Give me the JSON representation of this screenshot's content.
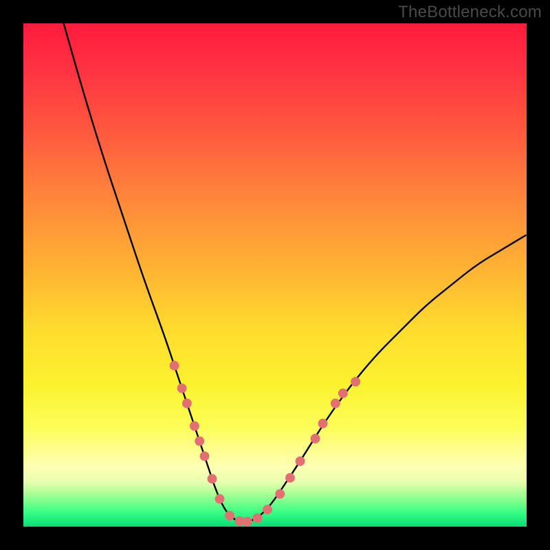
{
  "watermark": "TheBottleneck.com",
  "chart_data": {
    "type": "line",
    "title": "",
    "xlabel": "",
    "ylabel": "",
    "xlim": [
      0,
      100
    ],
    "ylim": [
      0,
      100
    ],
    "grid": false,
    "series": [
      {
        "name": "bottleneck-curve",
        "x": [
          8,
          12,
          16,
          20,
          24,
          28,
          30,
          32,
          33,
          34,
          35,
          36,
          37,
          38,
          39,
          40,
          41,
          42,
          43,
          44,
          45,
          46,
          48,
          50,
          52,
          55,
          60,
          65,
          70,
          75,
          80,
          85,
          90,
          95,
          100
        ],
        "y": [
          100,
          86,
          73,
          61,
          49,
          38,
          32,
          26,
          23,
          20,
          17,
          14,
          11,
          8,
          5.5,
          3.5,
          2.2,
          1.4,
          1.1,
          1.0,
          1.1,
          1.5,
          3,
          5.5,
          8.5,
          13,
          21,
          28,
          34,
          39,
          44,
          48,
          52,
          55,
          58
        ]
      }
    ],
    "markers": {
      "name": "highlighted-points",
      "color": "#e26f72",
      "radius_pct": 0.95,
      "points": [
        {
          "x": 30,
          "y": 32
        },
        {
          "x": 31.5,
          "y": 27.5
        },
        {
          "x": 32.5,
          "y": 24.5
        },
        {
          "x": 34,
          "y": 20
        },
        {
          "x": 35,
          "y": 17
        },
        {
          "x": 36,
          "y": 14
        },
        {
          "x": 37.5,
          "y": 9.5
        },
        {
          "x": 39,
          "y": 5.5
        },
        {
          "x": 41,
          "y": 2.2
        },
        {
          "x": 43,
          "y": 1.1
        },
        {
          "x": 44.5,
          "y": 1.0
        },
        {
          "x": 46.5,
          "y": 1.7
        },
        {
          "x": 48.5,
          "y": 3.4
        },
        {
          "x": 51,
          "y": 6.5
        },
        {
          "x": 53,
          "y": 9.7
        },
        {
          "x": 55,
          "y": 13
        },
        {
          "x": 58,
          "y": 17.5
        },
        {
          "x": 59.5,
          "y": 20.5
        },
        {
          "x": 62,
          "y": 24.5
        },
        {
          "x": 63.5,
          "y": 26.5
        },
        {
          "x": 66,
          "y": 28.8
        }
      ]
    }
  }
}
